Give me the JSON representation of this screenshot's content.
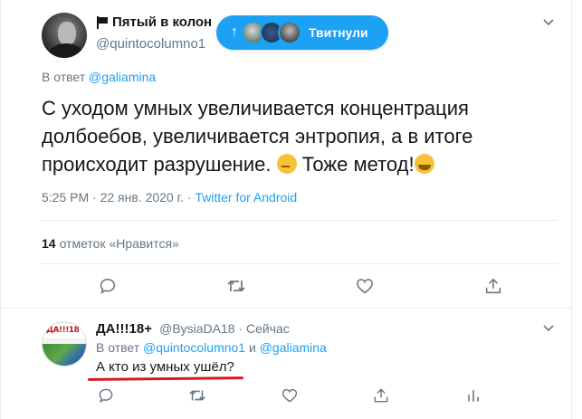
{
  "main_tweet": {
    "display_name": "Пятый в колон",
    "handle": "@quintocolumno1",
    "reply_prefix": "В ответ",
    "reply_to": "@galiamina",
    "text_before_emoji1": "С уходом умных увеличивается концентрация долбоебов, увеличивается энтропия, а в итоге происходит разрушение. ",
    "text_between_emojis": " Тоже метод!",
    "emoji1": "thinking-face",
    "emoji2": "hugging-face",
    "time_date": "5:25 PM · 22 янв. 2020 г. · ",
    "source_app": "Twitter for Android",
    "likes_count": "14",
    "likes_label": "отметок «Нравится»",
    "actions": [
      "reply",
      "retweet",
      "like",
      "share"
    ]
  },
  "new_tweets_pill": {
    "arrow": "↑",
    "label": "Твитнули"
  },
  "reply_tweet": {
    "display_name": "ДА!!!18+",
    "handle_time": "@BysiaDA18 · Сейчас",
    "reply_prefix": "В ответ",
    "reply_to_1": "@quintocolumno1",
    "reply_joiner": " и ",
    "reply_to_2": "@galiamina",
    "text": "А кто из умных ушёл?",
    "actions": [
      "reply",
      "retweet",
      "like",
      "share",
      "analytics"
    ]
  },
  "colors": {
    "accent": "#1da1f2",
    "muted_text": "#657786",
    "underline_red": "#d7191f"
  }
}
